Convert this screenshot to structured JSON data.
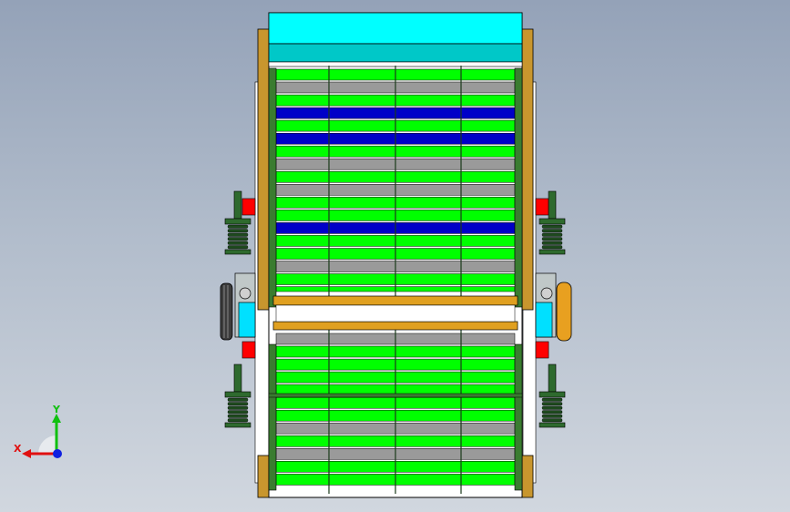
{
  "viewport": {
    "background_top": "#94a2b8",
    "background_bottom": "#d1d7df"
  },
  "model": {
    "part_colors": {
      "frame_outline": "#000000",
      "hopper_top": "#00ffff",
      "hopper_lower": "#00c8c8",
      "side_plate": "#c8962e",
      "side_rail": "#3a7c30",
      "deck_green": "#00ff00",
      "deck_blue": "#0000c8",
      "deck_gray": "#9a9a9a",
      "beam_orange": "#e0a020",
      "motor_cyan": "#00e0ff",
      "bearing_red": "#ff0000",
      "spring_dark": "#1e4a1e",
      "support_white": "#ffffff",
      "pulley_dark": "#3c3c3c"
    },
    "deck_strip_pattern": [
      "green",
      "gray",
      "green",
      "blue",
      "green",
      "blue",
      "green",
      "gray",
      "green",
      "gray",
      "green",
      "green",
      "blue",
      "green",
      "green",
      "gray",
      "green",
      "green",
      "gray",
      "green",
      "green",
      "green",
      "green",
      "green",
      "green",
      "gray",
      "green",
      "gray",
      "green",
      "green"
    ]
  },
  "triad": {
    "x_label": "X",
    "y_label": "Y",
    "x_color": "#e01010",
    "y_color": "#10c010",
    "z_color": "#1020e0"
  }
}
